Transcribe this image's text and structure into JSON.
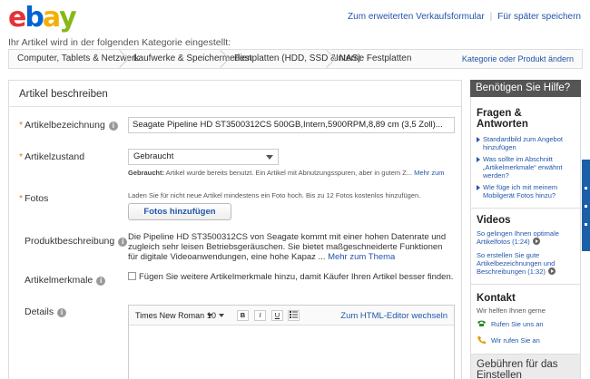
{
  "header": {
    "logo_letters": [
      {
        "ch": "e",
        "color": "#e53238"
      },
      {
        "ch": "b",
        "color": "#0064d2"
      },
      {
        "ch": "a",
        "color": "#f5af02"
      },
      {
        "ch": "y",
        "color": "#86b817"
      }
    ],
    "link_advanced": "Zum erweiterten Verkaufsformular",
    "link_save": "Für später speichern"
  },
  "category": {
    "label": "Ihr Artikel wird in der folgenden Kategorie eingestellt:",
    "crumbs": [
      "Computer, Tablets & Netzwerk",
      "Laufwerke & Speichermedien",
      "Festplatten (HDD, SSD & NAS)",
      "Interne Festplatten"
    ],
    "change_link": "Kategorie oder Produkt ändern"
  },
  "form": {
    "section_title": "Artikel beschreiben",
    "title_label": "Artikelbezeichnung",
    "title_value": "Seagate Pipeline HD ST3500312CS 500GB,Intern,5900RPM,8,89 cm (3,5 Zoll)...",
    "condition_label": "Artikelzustand",
    "condition_value": "Gebraucht",
    "condition_help_bold": "Gebraucht:",
    "condition_help": " Artikel wurde bereits benutzt. Ein Artikel mit Abnutzungsspuren, aber in gutem Z... ",
    "condition_more": "Mehr zum",
    "photos_label": "Fotos",
    "photos_hint": "Laden Sie für nicht neue Artikel mindestens ein Foto hoch. Bis zu 12 Fotos kostenlos hinzufügen.",
    "photos_button": "Fotos hinzufügen",
    "product_desc_label": "Produktbeschreibung",
    "product_desc": "Die Pipeline HD ST3500312CS von Seagate kommt mit einer hohen Datenrate und zugleich sehr leisen Betriebsgeräuschen. Sie bietet maßgeschneiderte Funktionen für digitale Videoanwendungen, eine hohe Kapaz ... ",
    "product_desc_more": "Mehr zum Thema",
    "features_label": "Artikelmerkmale",
    "features_text": "Fügen Sie weitere Artikelmerkmale hinzu, damit Käufer Ihren Artikel besser finden.",
    "details_label": "Details",
    "editor": {
      "font": "Times New Roman",
      "size": "10",
      "bold": "B",
      "italic": "I",
      "underline": "U",
      "html_link": "Zum HTML-Editor wechseln"
    }
  },
  "sidebar": {
    "help_header": "Benötigen Sie Hilfe?",
    "faq_title": "Fragen & Antworten",
    "faq": [
      "Standardbild zum Angebot hinzufügen",
      "Was sollte im Abschnitt „Artikelmerkmale“ erwähnt werden?",
      "Wie füge ich mit meinem Mobilgerät Fotos hinzu?"
    ],
    "videos_title": "Videos",
    "videos": [
      "So gelingen Ihnen optimale Artikelfotos (1:24)",
      "So erstellen Sie gute Artikelbezeichnungen und Beschreibungen (1:32)"
    ],
    "contact_title": "Kontakt",
    "contact_sub": "Wir helfen Ihnen gerne",
    "contact_call": "Rufen Sie uns an",
    "contact_callback": "Wir rufen Sie an",
    "fees_title": "Gebühren für das Einstellen"
  },
  "colors": {
    "link": "#2255aa",
    "required_star": "#e07a14",
    "help_header_bg": "#555555",
    "side_tab": "#1a5fa8"
  }
}
